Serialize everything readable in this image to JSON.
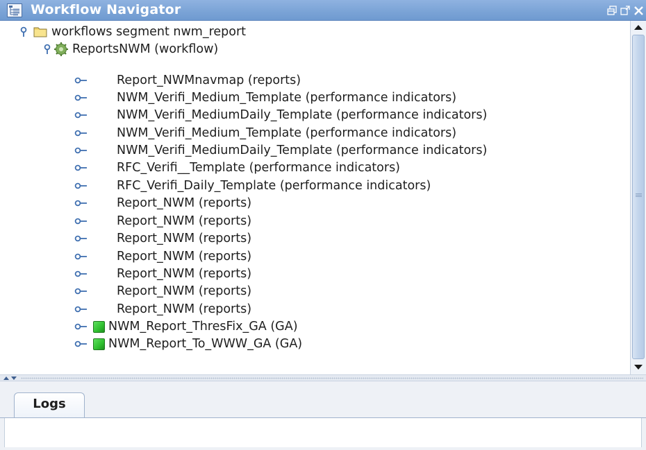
{
  "window": {
    "title": "Workflow Navigator",
    "icon": "tree-view-icon",
    "buttons": [
      "float-window-icon",
      "maximize-window-icon",
      "close-window-icon"
    ]
  },
  "tree": {
    "root": {
      "label": "workflows  segment nwm_report",
      "icon": "folder-icon"
    },
    "workflow": {
      "label": "ReportsNWM  (workflow)",
      "icon": "gear-cluster-icon"
    },
    "items": [
      {
        "label": "Report_NWMnavmap  (reports)"
      },
      {
        "label": "NWM_Verifi_Medium_Template  (performance indicators)"
      },
      {
        "label": "NWM_Verifi_MediumDaily_Template  (performance indicators)"
      },
      {
        "label": "NWM_Verifi_Medium_Template  (performance indicators)"
      },
      {
        "label": "NWM_Verifi_MediumDaily_Template  (performance indicators)"
      },
      {
        "label": "RFC_Verifi__Template  (performance indicators)"
      },
      {
        "label": "RFC_Verifi_Daily_Template  (performance indicators)"
      },
      {
        "label": "Report_NWM  (reports)"
      },
      {
        "label": "Report_NWM  (reports)"
      },
      {
        "label": "Report_NWM  (reports)"
      },
      {
        "label": "Report_NWM  (reports)"
      },
      {
        "label": "Report_NWM  (reports)"
      },
      {
        "label": "Report_NWM  (reports)"
      },
      {
        "label": "Report_NWM  (reports)"
      },
      {
        "label": "NWM_Report_ThresFix_GA  (GA)",
        "status_color": "#2fbf2f"
      },
      {
        "label": "NWM_Report_To_WWW_GA  (GA)",
        "status_color": "#2fbf2f"
      }
    ]
  },
  "logs": {
    "tab_label": "Logs"
  },
  "colors": {
    "title_bar": "#7aa3d6",
    "node_handle": "#3f6fb0",
    "ga_status": "#2fbf2f"
  }
}
